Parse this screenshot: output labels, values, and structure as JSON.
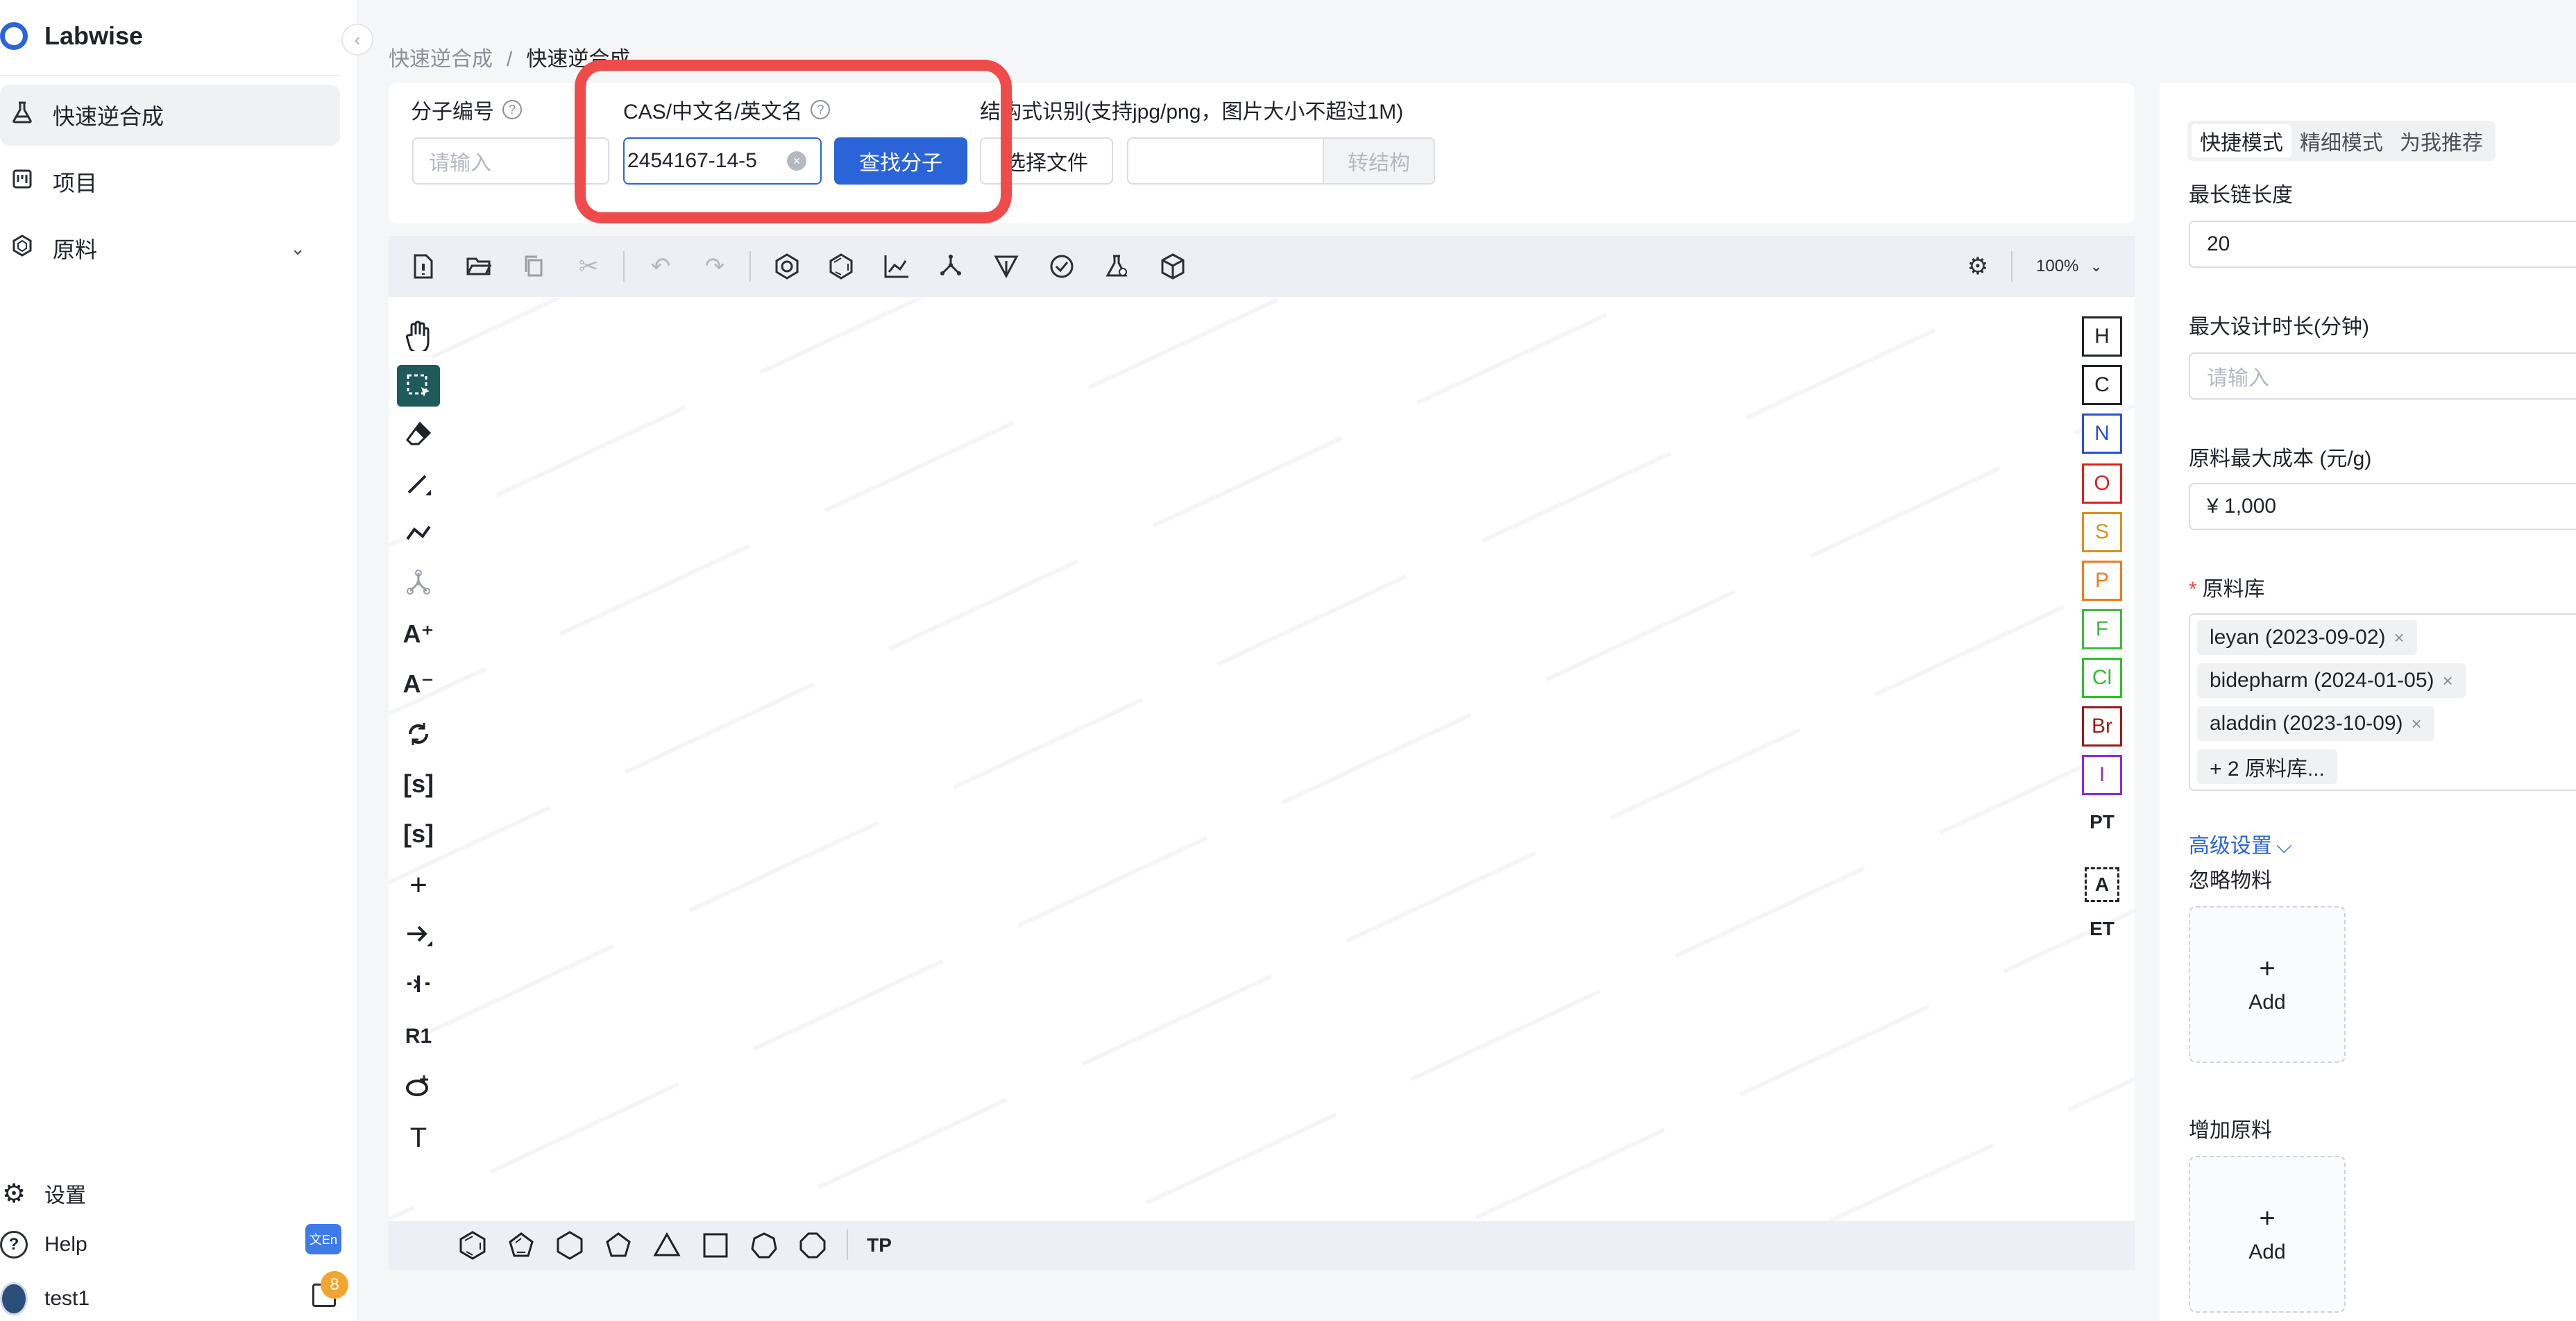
{
  "app": {
    "name": "Labwise"
  },
  "sidebar": {
    "items": [
      {
        "label": "快速逆合成",
        "icon": "flask-icon",
        "active": true
      },
      {
        "label": "项目",
        "icon": "project-icon",
        "active": false
      },
      {
        "label": "原料",
        "icon": "hexagon-icon",
        "active": false,
        "expandable": true
      }
    ],
    "bottom": {
      "settings_label": "设置",
      "help_label": "Help",
      "user_label": "test1",
      "notification_count": "8",
      "lang_icon_text": "文En"
    }
  },
  "breadcrumb": {
    "parent": "快速逆合成",
    "separator": "/",
    "current": "快速逆合成"
  },
  "search": {
    "molecule_id_label": "分子编号",
    "molecule_id_placeholder": "请输入",
    "cas_label": "CAS/中文名/英文名",
    "cas_value": "2454167-14-5",
    "find_button": "查找分子",
    "structure_label": "结构式识别(支持jpg/png，图片大小不超过1M)",
    "choose_file_button": "选择文件",
    "convert_button": "转结构",
    "structure_input_value": ""
  },
  "editor": {
    "zoom": "100%",
    "top_tools": [
      "new-document-icon",
      "open-folder-icon",
      "copy-icon",
      "cut-icon",
      "undo-icon",
      "redo-icon",
      "aromatize-icon",
      "dearomatize-icon",
      "layout-icon",
      "clean-icon",
      "stereo-icon",
      "check-icon",
      "calculate-icon",
      "3d-icon"
    ],
    "left_tools": [
      "hand-icon",
      "select-icon",
      "eraser-icon",
      "bond-icon",
      "chain-icon",
      "charge-structure-icon",
      "charge-plus-icon",
      "charge-minus-icon",
      "rotate-icon",
      "sgroup-icon",
      "sgroup-add-icon",
      "plus-icon",
      "arrow-icon",
      "rgroup-attachment-icon",
      "rgroup-label-icon",
      "template-icon",
      "text-icon"
    ],
    "left_text": {
      "charge_plus": "A⁺",
      "charge_minus": "A⁻",
      "sgroup": "[s]",
      "sgroup_add": "[s]",
      "plus": "+",
      "rgroup": "R1",
      "text": "T"
    },
    "atoms": [
      {
        "symbol": "H",
        "color": "#1f2329"
      },
      {
        "symbol": "C",
        "color": "#1f2329"
      },
      {
        "symbol": "N",
        "color": "#2b4fd6"
      },
      {
        "symbol": "O",
        "color": "#e02020"
      },
      {
        "symbol": "S",
        "color": "#d9921a"
      },
      {
        "symbol": "P",
        "color": "#f07a1e"
      },
      {
        "symbol": "F",
        "color": "#3fb73f"
      },
      {
        "symbol": "Cl",
        "color": "#2fbf2f"
      },
      {
        "symbol": "Br",
        "color": "#9b1b1b"
      },
      {
        "symbol": "I",
        "color": "#8a2be2"
      }
    ],
    "right_text": {
      "periodic_table": "PT",
      "any_atom": "A",
      "extended_table": "ET"
    },
    "bottom_text": {
      "template_library": "TP"
    }
  },
  "settings_panel": {
    "tabs": [
      {
        "label": "快捷模式",
        "active": true
      },
      {
        "label": "精细模式",
        "active": false
      },
      {
        "label": "为我推荐",
        "active": false
      }
    ],
    "max_chain_label": "最长链长度",
    "max_chain_value": "20",
    "max_time_label": "最大设计时长(分钟)",
    "max_time_placeholder": "请输入",
    "max_cost_label": "原料最大成本 (元/g)",
    "max_cost_value": "¥ 1,000",
    "library_label": "原料库",
    "library_required": "*",
    "libraries": [
      "leyan (2023-09-02)",
      "bidepharm (2024-01-05)",
      "aladdin (2023-10-09)",
      "+ 2 原料库..."
    ],
    "advanced_label": "高级设置",
    "ignore_label": "忽略物料",
    "add_label_1": "Add",
    "add_material_label": "增加原料",
    "add_label_2": "Add"
  },
  "colors": {
    "accent": "#2a64d8",
    "highlight": "#ef4b4b",
    "active_tool": "#1e5a5c"
  }
}
